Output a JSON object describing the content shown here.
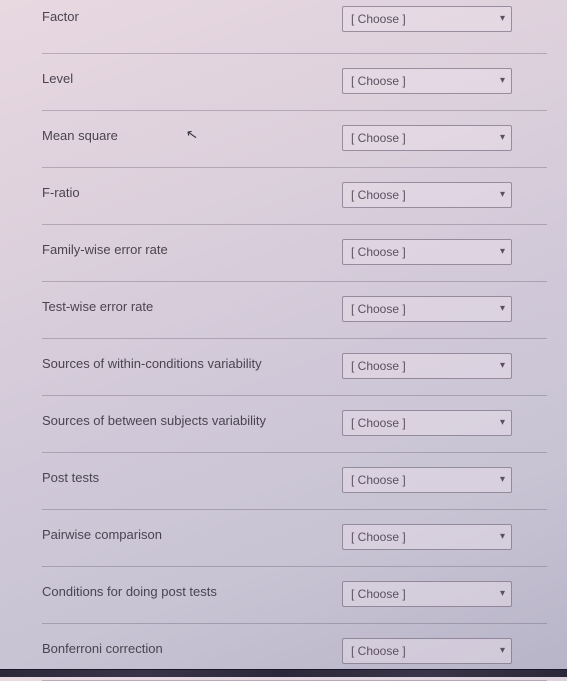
{
  "rows": [
    {
      "label": "Factor",
      "selected": "[ Choose ]"
    },
    {
      "label": "Level",
      "selected": "[ Choose ]"
    },
    {
      "label": "Mean square",
      "selected": "[ Choose ]"
    },
    {
      "label": "F-ratio",
      "selected": "[ Choose ]"
    },
    {
      "label": "Family-wise error rate",
      "selected": "[ Choose ]"
    },
    {
      "label": "Test-wise error rate",
      "selected": "[ Choose ]"
    },
    {
      "label": "Sources of within-conditions variability",
      "selected": "[ Choose ]"
    },
    {
      "label": "Sources of between subjects variability",
      "selected": "[ Choose ]"
    },
    {
      "label": "Post tests",
      "selected": "[ Choose ]"
    },
    {
      "label": "Pairwise comparison",
      "selected": "[ Choose ]"
    },
    {
      "label": "Conditions for doing post tests",
      "selected": "[ Choose ]"
    },
    {
      "label": "Bonferroni correction",
      "selected": "[ Choose ]"
    }
  ]
}
